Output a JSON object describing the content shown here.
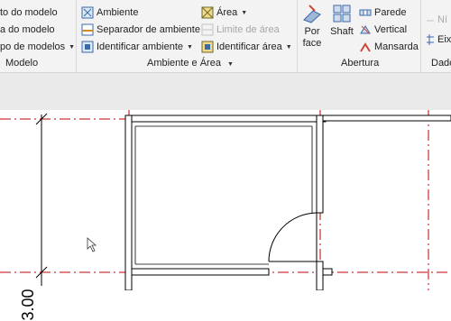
{
  "ribbon": {
    "modelo_panel": {
      "items": [
        {
          "label": "to do modelo"
        },
        {
          "label": "a do modelo"
        },
        {
          "label": "po de modelos",
          "dropdown": true
        }
      ],
      "title": "Modelo"
    },
    "ambiente_panel": {
      "items": [
        {
          "label": "Ambiente",
          "icon": "room-icon"
        },
        {
          "label": "Separador de ambiente",
          "icon": "room-separator-icon"
        },
        {
          "label": "Identificar ambiente",
          "icon": "tag-room-icon",
          "dropdown": true
        },
        {
          "label": "Área",
          "icon": "area-icon",
          "dropdown": true
        },
        {
          "label": "Limite de área",
          "icon": "area-boundary-icon",
          "disabled": true
        },
        {
          "label": "Identificar área",
          "icon": "tag-area-icon",
          "dropdown": true
        }
      ],
      "title": "Ambiente e Área"
    },
    "abertura_panel": {
      "big_buttons": [
        {
          "label_line1": "Por",
          "label_line2": "face",
          "icon": "by-face-icon"
        },
        {
          "label_line1": "Shaft",
          "icon": "shaft-icon"
        }
      ],
      "items": [
        {
          "label": "Parede",
          "icon": "wall-opening-icon"
        },
        {
          "label": "Vertical",
          "icon": "vertical-opening-icon"
        },
        {
          "label": "Mansarda",
          "icon": "dormer-icon"
        }
      ],
      "title": "Abertura"
    },
    "dado_panel": {
      "items": [
        {
          "label": "Ní",
          "icon": "level-icon",
          "disabled": true
        },
        {
          "label": "Eix",
          "icon": "grid-icon"
        }
      ],
      "title": "Dado"
    }
  },
  "canvas": {
    "dimension_label": "3.00"
  },
  "colors": {
    "grid_line": "#c00000",
    "wall": "#000000"
  }
}
